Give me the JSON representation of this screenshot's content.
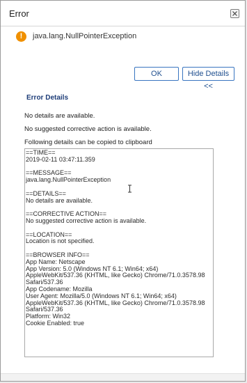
{
  "dialog": {
    "title": "Error",
    "close_icon": "close-icon"
  },
  "message": {
    "icon": "warning-icon",
    "icon_glyph": "!",
    "text": "java.lang.NullPointerException",
    "icon_color": "#f09000"
  },
  "buttons": {
    "ok_label": "OK",
    "details_label": "Hide Details <<"
  },
  "details": {
    "title": "Error Details",
    "lines": [
      "No details are available.",
      "No suggested corrective action is available.",
      "Following details can be copied to clipboard"
    ],
    "clipboard_text": "==TIME==\n2019-02-11 03:47:11.359\n\n==MESSAGE==\njava.lang.NullPointerException\n\n==DETAILS==\nNo details are available.\n\n==CORRECTIVE ACTION==\nNo suggested corrective action is available.\n\n==LOCATION==\nLocation is not specified.\n\n==BROWSER INFO==\nApp Name: Netscape\nApp Version: 5.0 (Windows NT 6.1; Win64; x64)\nAppleWebKit/537.36 (KHTML, like Gecko) Chrome/71.0.3578.98\nSafari/537.36\nApp Codename: Mozilla\nUser Agent: Mozilla/5.0 (Windows NT 6.1; Win64; x64)\nAppleWebKit/537.36 (KHTML, like Gecko) Chrome/71.0.3578.98\nSafari/537.36\nPlatform: Win32\nCookie Enabled: true"
  },
  "colors": {
    "accent": "#3875c0",
    "section_title": "#1e3d78"
  }
}
